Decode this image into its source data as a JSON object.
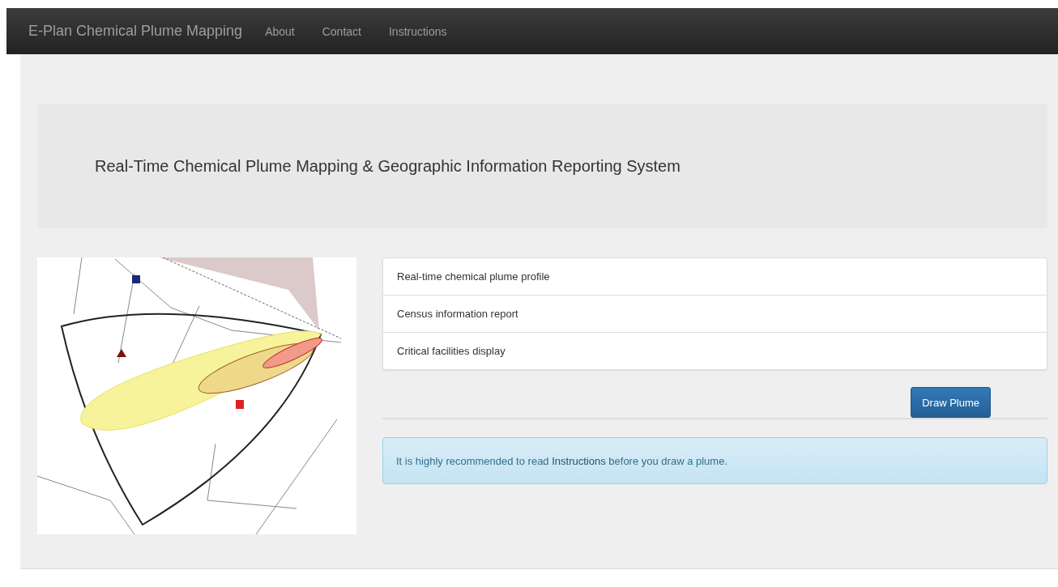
{
  "navbar": {
    "brand": "E-Plan Chemical Plume Mapping",
    "links": [
      "About",
      "Contact",
      "Instructions"
    ]
  },
  "jumbotron": {
    "title": "Real-Time Chemical Plume Mapping & Geographic Information Reporting System"
  },
  "features": [
    "Real-time chemical plume profile",
    "Census information report",
    "Critical facilities display"
  ],
  "draw_button": "Draw Plume",
  "alert": {
    "before": "It is highly recommended to read ",
    "link": "Instructions",
    "after": " before you draw a plume."
  }
}
